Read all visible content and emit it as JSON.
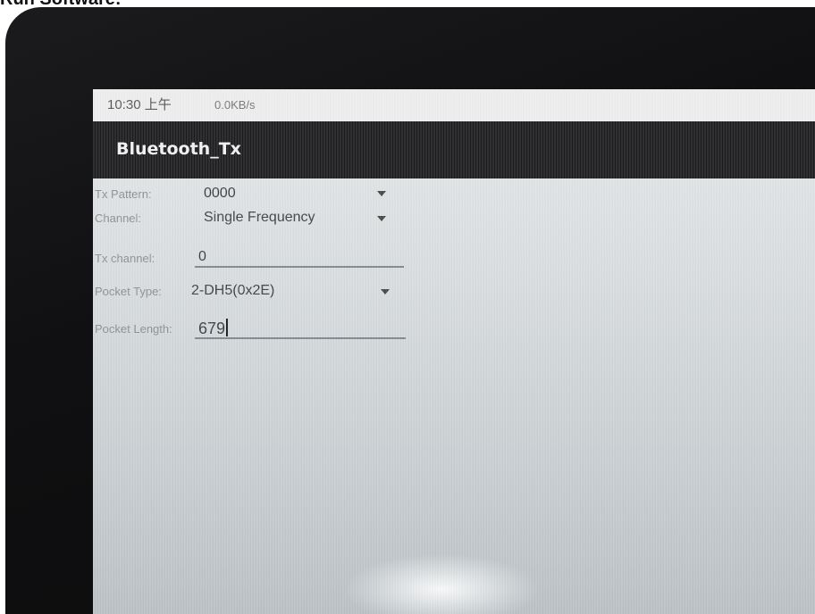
{
  "caption": "Run Software:",
  "statusbar": {
    "time": "10:30 上午",
    "net_speed": "0.0KB/s"
  },
  "appbar": {
    "title": "Bluetooth_Tx"
  },
  "form": {
    "tx_pattern": {
      "label": "Tx Pattern:",
      "value": "0000"
    },
    "channel": {
      "label": "Channel:",
      "value": "Single Frequency"
    },
    "tx_channel": {
      "label": "Tx channel:",
      "value": "0"
    },
    "pocket_type": {
      "label": "Pocket Type:",
      "value": "2-DH5(0x2E)"
    },
    "pocket_length": {
      "label": "Pocket Length:",
      "value": "679"
    }
  },
  "icons": {
    "dropdown": "triangle-down-icon"
  },
  "colors": {
    "appbar": "#1c1c1e",
    "statusbar": "#eeeeee",
    "bezel": "#101012"
  }
}
